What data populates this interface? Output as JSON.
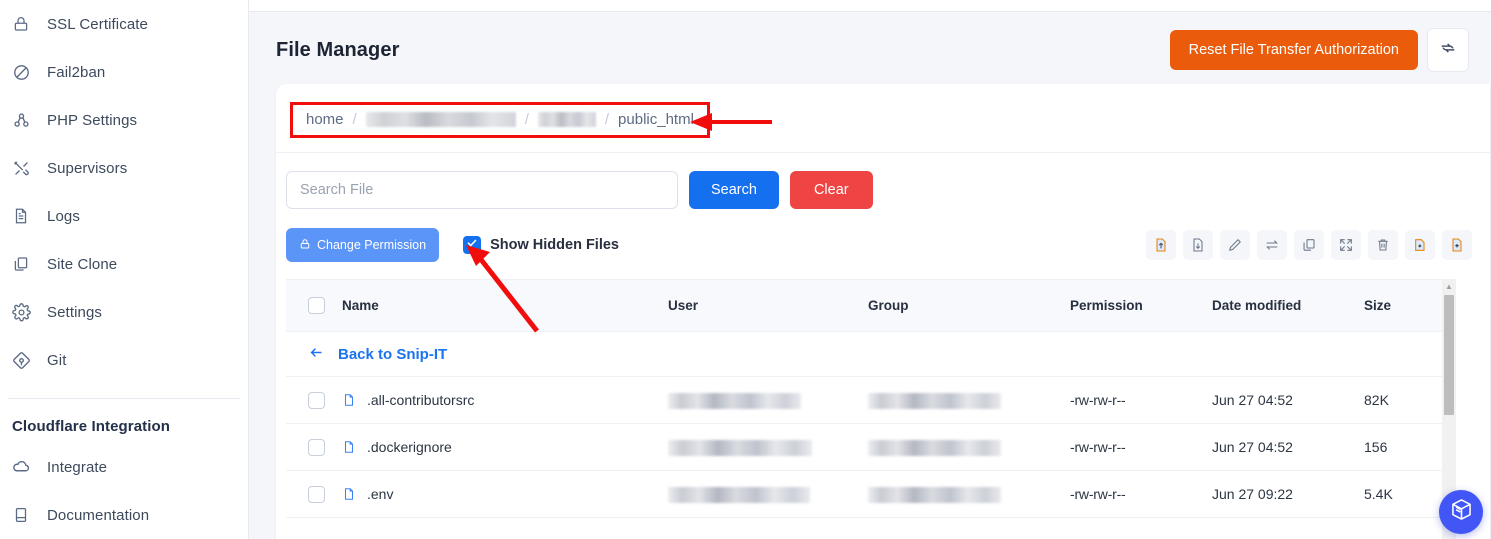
{
  "sidebar": {
    "items": [
      {
        "label": "SSL Certificate",
        "icon": "lock-icon"
      },
      {
        "label": "Fail2ban",
        "icon": "ban-icon"
      },
      {
        "label": "PHP Settings",
        "icon": "nodes-icon"
      },
      {
        "label": "Supervisors",
        "icon": "tools-icon"
      },
      {
        "label": "Logs",
        "icon": "document-icon"
      },
      {
        "label": "Site Clone",
        "icon": "copy-icon"
      },
      {
        "label": "Settings",
        "icon": "gear-icon"
      },
      {
        "label": "Git",
        "icon": "git-icon"
      }
    ],
    "section_title": "Cloudflare Integration",
    "section_items": [
      {
        "label": "Integrate",
        "icon": "cloud-icon"
      },
      {
        "label": "Documentation",
        "icon": "book-icon"
      }
    ]
  },
  "header": {
    "title": "File Manager",
    "reset_label": "Reset File Transfer Authorization",
    "reset_color": "#ea5b0c",
    "refresh_icon": "refresh-icon"
  },
  "breadcrumb": {
    "highlight_color": "#f20d0d",
    "segments": [
      {
        "label": "home",
        "redacted": false
      },
      {
        "label": "",
        "redacted": true,
        "width": 150
      },
      {
        "label": "",
        "redacted": true,
        "width": 58
      },
      {
        "label": "public_html",
        "redacted": false
      }
    ],
    "separator": "/"
  },
  "search": {
    "placeholder": "Search File",
    "value": "",
    "search_label": "Search",
    "clear_label": "Clear",
    "search_color": "#1570ef",
    "clear_color": "#ef4444"
  },
  "actions": {
    "change_permission_label": "Change Permission",
    "change_permission_icon": "lock-icon",
    "change_permission_color": "#5b95f7",
    "show_hidden_label": "Show Hidden Files",
    "show_hidden_checked": true,
    "tools": [
      {
        "name": "upload-file-icon",
        "active": true
      },
      {
        "name": "download-file-icon",
        "active": false
      },
      {
        "name": "edit-pencil-icon",
        "active": false
      },
      {
        "name": "transfer-arrows-icon",
        "active": false
      },
      {
        "name": "copy-icon",
        "active": false
      },
      {
        "name": "compress-icon",
        "active": false
      },
      {
        "name": "trash-icon",
        "active": false
      },
      {
        "name": "new-folder-icon",
        "active": true
      },
      {
        "name": "new-file-icon",
        "active": true
      }
    ]
  },
  "table": {
    "columns": [
      "Name",
      "User",
      "Group",
      "Permission",
      "Date modified",
      "Size"
    ],
    "back_link": "Back to Snip-IT",
    "rows": [
      {
        "name": ".all-contributorsrc",
        "user_redacted": true,
        "user_width": 133,
        "group_redacted": true,
        "group_width": 133,
        "permission": "-rw-rw-r--",
        "date_modified": "Jun 27 04:52",
        "size": "82K"
      },
      {
        "name": ".dockerignore",
        "user_redacted": true,
        "user_width": 144,
        "group_redacted": true,
        "group_width": 133,
        "permission": "-rw-rw-r--",
        "date_modified": "Jun 27 04:52",
        "size": "156"
      },
      {
        "name": ".env",
        "user_redacted": true,
        "user_width": 142,
        "group_redacted": true,
        "group_width": 133,
        "permission": "-rw-rw-r--",
        "date_modified": "Jun 27 09:22",
        "size": "5.4K"
      }
    ]
  },
  "fab": {
    "icon": "cube-icon",
    "color": "#4256f5"
  },
  "annotations": {
    "color": "#f20d0d",
    "arrow_breadcrumb": "points-left-to-breadcrumb",
    "arrow_checkbox": "points-up-left-to-show-hidden-checkbox"
  }
}
